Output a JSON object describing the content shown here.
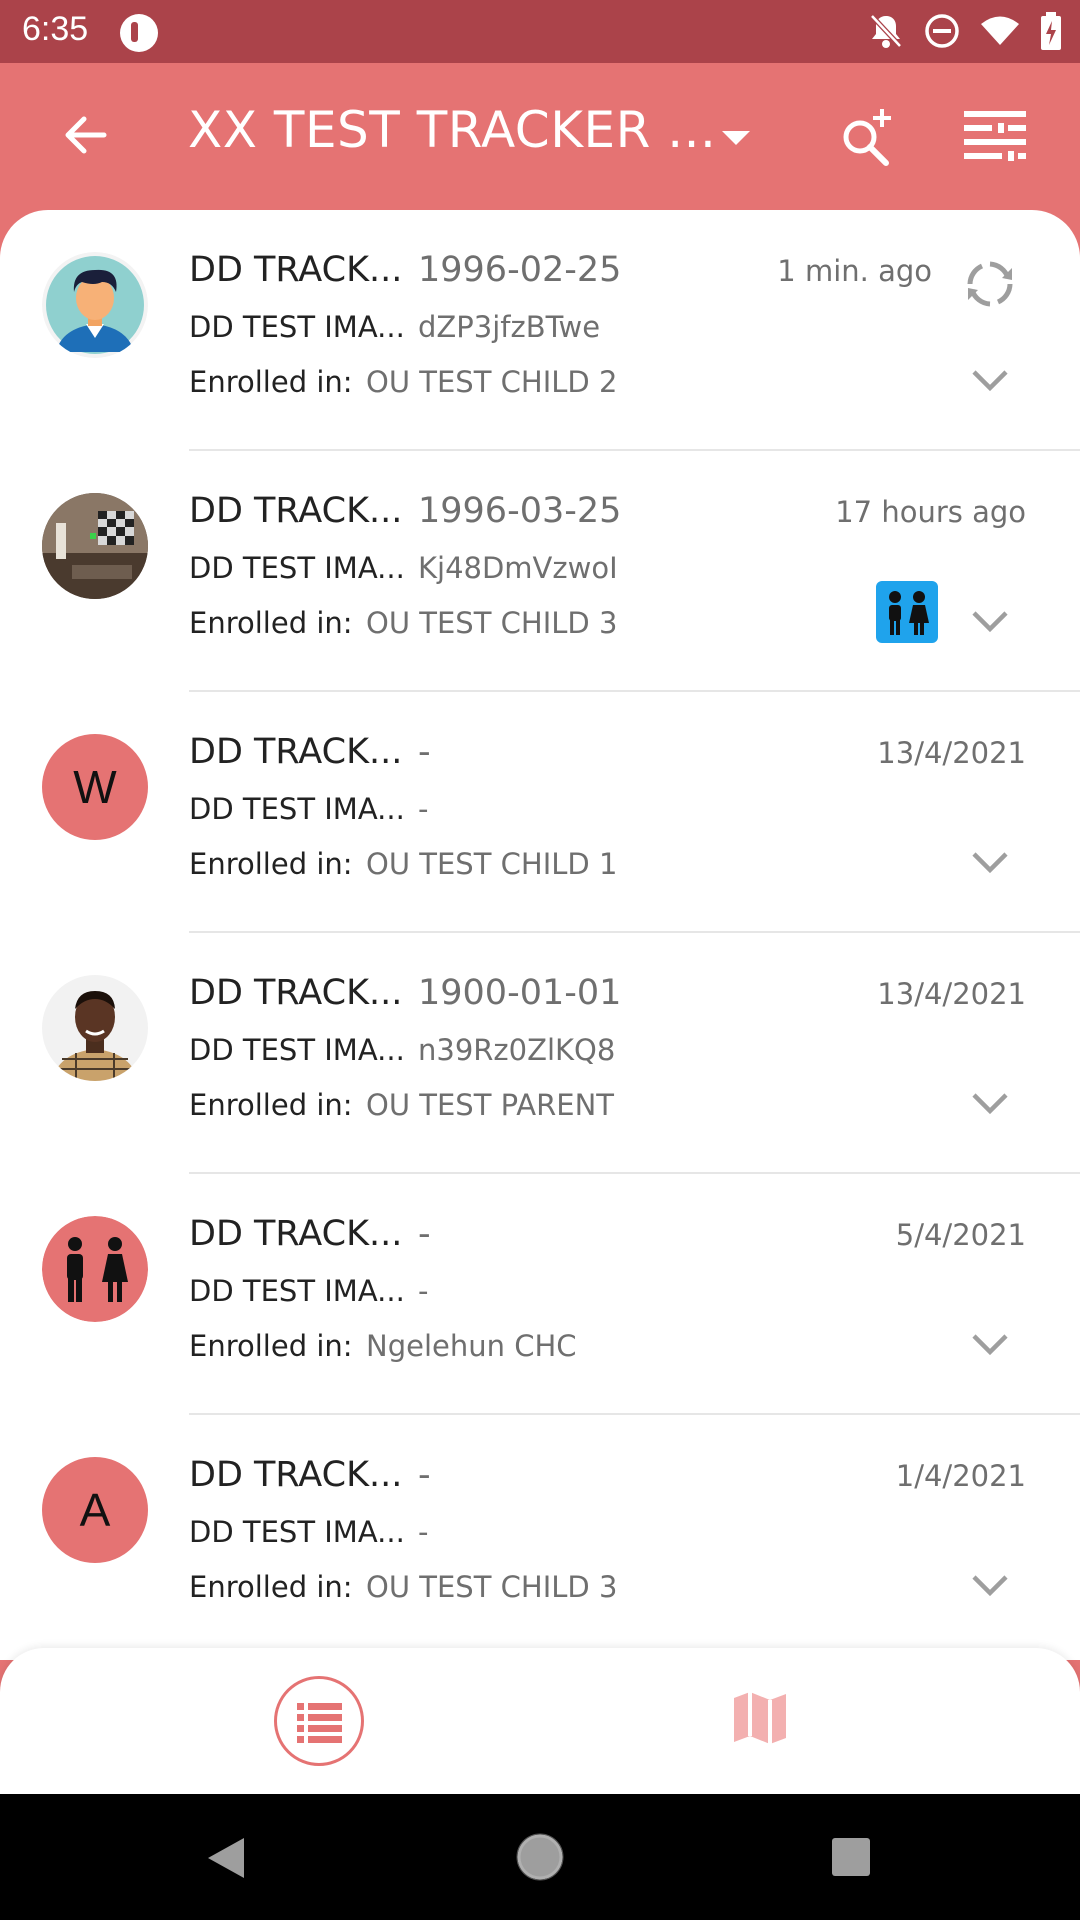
{
  "status_bar": {
    "time": "6:35",
    "icons": [
      "app-notification-icon",
      "notifications-off-icon",
      "do-not-disturb-icon",
      "wifi-icon",
      "battery-charging-icon"
    ]
  },
  "toolbar": {
    "title": "XX TEST TRACKER ...",
    "icons": [
      "back-arrow-icon",
      "dropdown-arrow-icon",
      "search-add-icon",
      "filter-icon"
    ]
  },
  "colors": {
    "primary": "#e57373",
    "status_bar": "#ab434a",
    "badge_blue": "#1fa3ec"
  },
  "list": {
    "enrolled_label": "Enrolled in:",
    "items": [
      {
        "avatar_type": "cartoon-avatar",
        "name": "DD TRACK...",
        "attr1": "1996-02-25",
        "attr2_label": "DD TEST IMA...",
        "attr2_value": "dZP3jfzBTwe",
        "enrolled_in": "OU TEST CHILD 2",
        "time": "1 min. ago",
        "sync_icon": true
      },
      {
        "avatar_type": "room-photo",
        "name": "DD TRACK...",
        "attr1": "1996-03-25",
        "attr2_label": "DD TEST IMA...",
        "attr2_value": "Kj48DmVzwoI",
        "enrolled_in": "OU TEST CHILD 3",
        "time": "17 hours ago",
        "badge": "children-icon"
      },
      {
        "avatar_type": "letter",
        "avatar_letter": "W",
        "name": "DD TRACK...",
        "attr1": "-",
        "attr2_label": "DD TEST IMA...",
        "attr2_value": "-",
        "enrolled_in": "OU TEST CHILD 1",
        "time": "13/4/2021"
      },
      {
        "avatar_type": "person-photo",
        "name": "DD TRACK...",
        "attr1": "1900-01-01",
        "attr2_label": "DD TEST IMA...",
        "attr2_value": "n39Rz0ZlKQ8",
        "enrolled_in": "OU TEST PARENT",
        "time": "13/4/2021"
      },
      {
        "avatar_type": "people-icon",
        "name": "DD TRACK...",
        "attr1": "-",
        "attr2_label": "DD TEST IMA...",
        "attr2_value": "-",
        "enrolled_in": "Ngelehun CHC",
        "time": "5/4/2021"
      },
      {
        "avatar_type": "letter",
        "avatar_letter": "A",
        "name": "DD TRACK...",
        "attr1": "-",
        "attr2_label": "DD TEST IMA...",
        "attr2_value": "-",
        "enrolled_in": "OU TEST CHILD 3",
        "time": "1/4/2021"
      }
    ]
  },
  "bottom_nav": {
    "items": [
      "list-view-icon",
      "map-view-icon"
    ],
    "selected": "list-view-icon"
  },
  "system_nav": {
    "items": [
      "back-triangle-icon",
      "home-circle-icon",
      "recents-square-icon"
    ]
  }
}
